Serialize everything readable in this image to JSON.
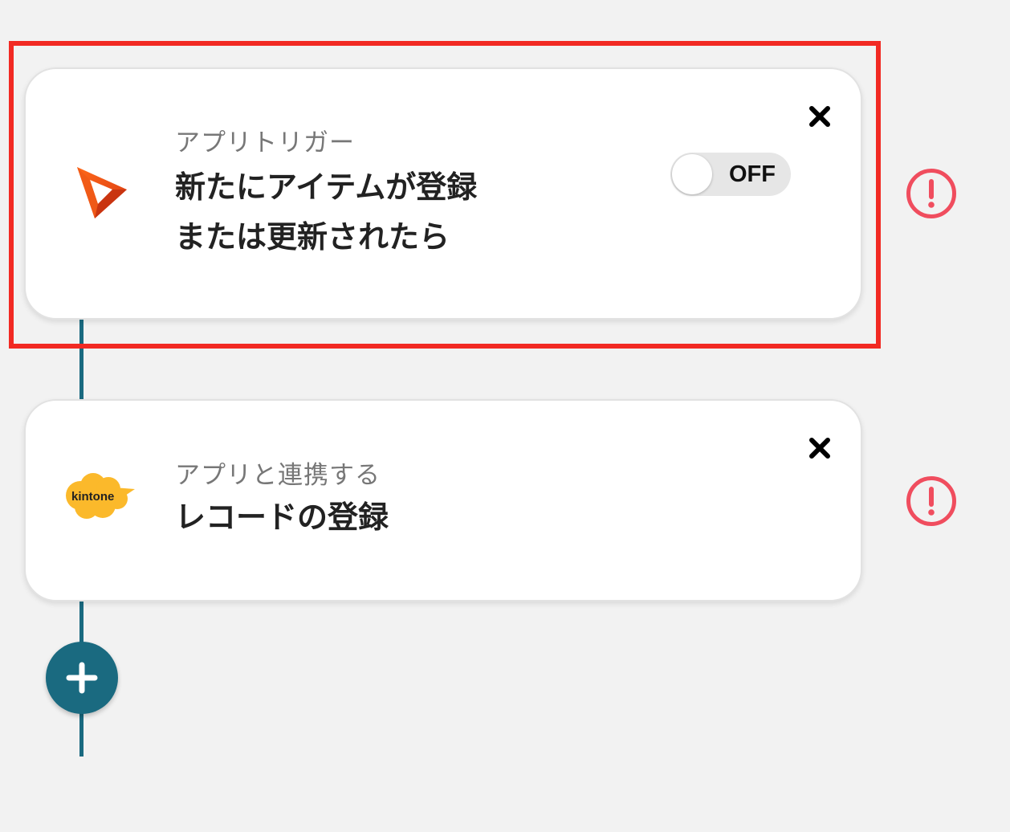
{
  "flow": {
    "steps": [
      {
        "kind_label": "アプリトリガー",
        "title_lines": [
          "新たにアイテムが登録",
          "または更新されたら"
        ],
        "app_icon": "orange-triangle-logo-icon",
        "toggle": {
          "state": "off",
          "label": "OFF"
        },
        "close_icon": "close-icon",
        "status_icon": "alert-circle-icon",
        "highlighted": true
      },
      {
        "kind_label": "アプリと連携する",
        "title_lines": [
          "レコードの登録"
        ],
        "app_icon": "kintone-logo-icon",
        "app_icon_text": "kintone",
        "close_icon": "close-icon",
        "status_icon": "alert-circle-icon",
        "highlighted": false
      }
    ],
    "add_button_icon": "plus-icon"
  },
  "colors": {
    "background": "#f2f2f2",
    "card_background": "#ffffff",
    "connector": "#1a6a80",
    "add_button": "#1a6a80",
    "alert": "#f04d5e",
    "highlight_frame": "#f22a23",
    "kintone_yellow": "#fbb92b"
  }
}
